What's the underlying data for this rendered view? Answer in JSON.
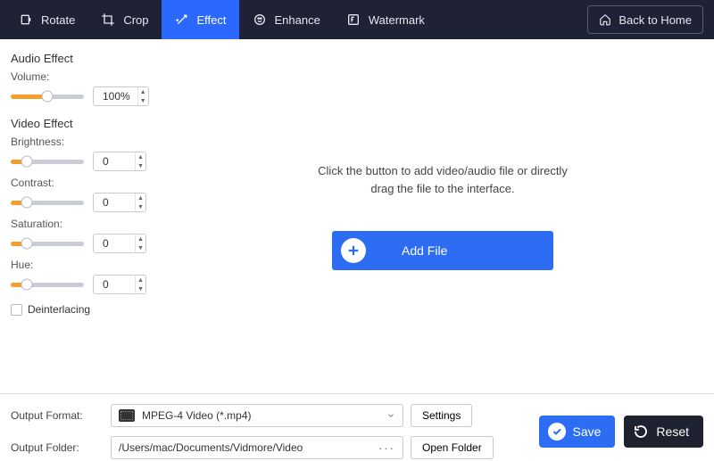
{
  "topbar": {
    "tabs": {
      "rotate": "Rotate",
      "crop": "Crop",
      "effect": "Effect",
      "enhance": "Enhance",
      "watermark": "Watermark"
    },
    "back_to_home": "Back to Home"
  },
  "sidebar": {
    "audio_effect_header": "Audio Effect",
    "volume_label": "Volume:",
    "volume_value": "100%",
    "video_effect_header": "Video Effect",
    "brightness_label": "Brightness:",
    "brightness_value": "0",
    "contrast_label": "Contrast:",
    "contrast_value": "0",
    "saturation_label": "Saturation:",
    "saturation_value": "0",
    "hue_label": "Hue:",
    "hue_value": "0",
    "deinterlacing_label": "Deinterlacing"
  },
  "preview": {
    "hint_line1": "Click the button to add video/audio file or directly",
    "hint_line2": "drag the file to the interface.",
    "add_file_label": "Add File"
  },
  "bottom": {
    "output_format_label": "Output Format:",
    "output_format_value": "MPEG-4 Video (*.mp4)",
    "settings_label": "Settings",
    "output_folder_label": "Output Folder:",
    "output_folder_value": "/Users/mac/Documents/Vidmore/Video",
    "open_folder_label": "Open Folder",
    "save_label": "Save",
    "reset_label": "Reset"
  }
}
